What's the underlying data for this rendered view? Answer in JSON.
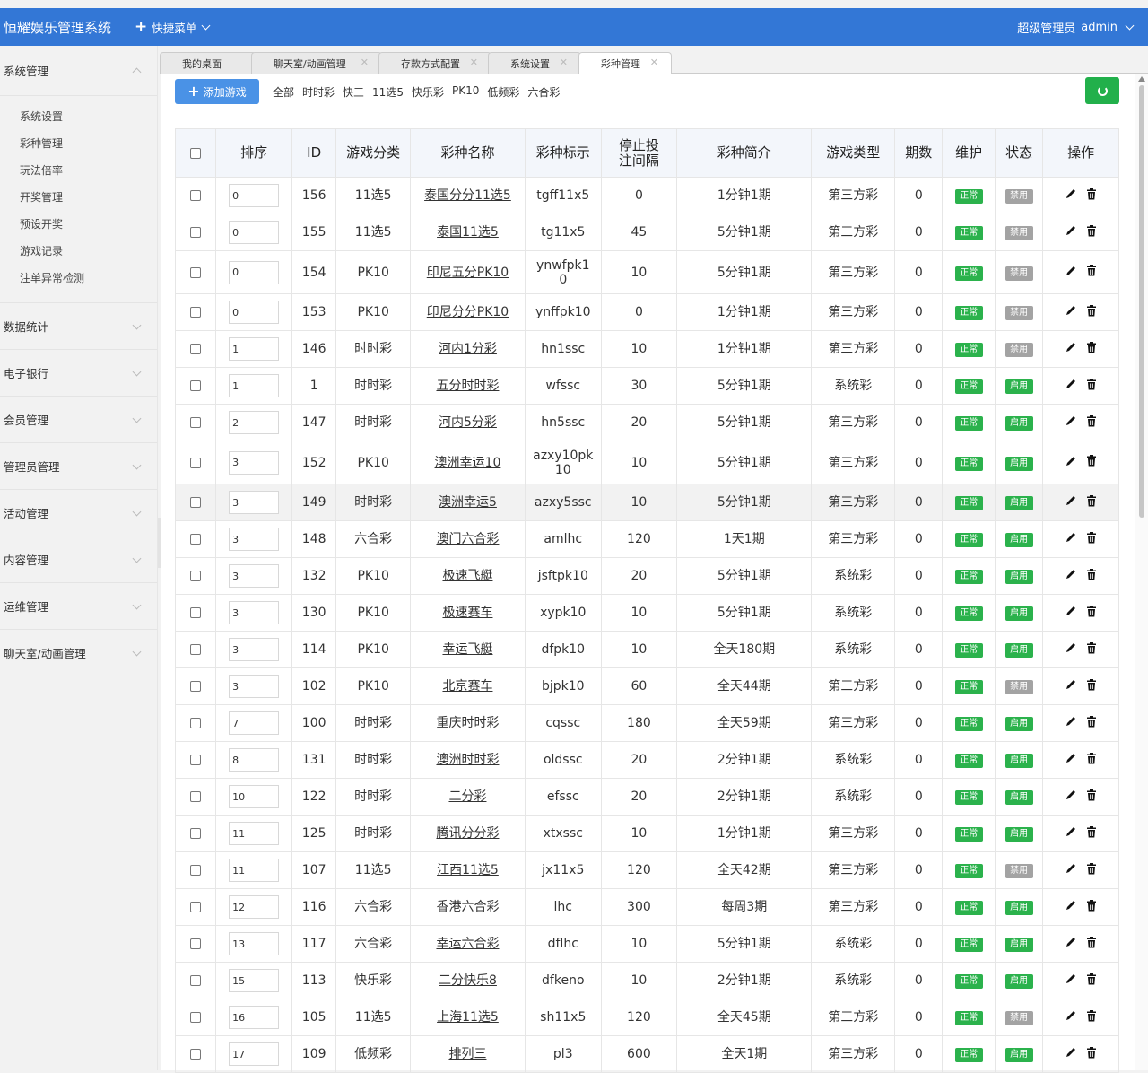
{
  "header": {
    "brand": "恒耀娱乐管理系统",
    "quick_menu": "快捷菜单",
    "user_role": "超级管理员",
    "user_name": "admin"
  },
  "sidebar": {
    "expanded": {
      "label": "系统管理",
      "items": [
        "系统设置",
        "彩种管理",
        "玩法倍率",
        "开奖管理",
        "预设开奖",
        "游戏记录",
        "注单异常检测"
      ]
    },
    "groups": [
      "数据统计",
      "电子银行",
      "会员管理",
      "管理员管理",
      "活动管理",
      "内容管理",
      "运维管理",
      "聊天室/动画管理"
    ]
  },
  "tabs": [
    {
      "label": "我的桌面",
      "closable": false
    },
    {
      "label": "聊天室/动画管理",
      "closable": true
    },
    {
      "label": "存款方式配置",
      "closable": true
    },
    {
      "label": "系统设置",
      "closable": true
    },
    {
      "label": "彩种管理",
      "closable": true,
      "active": true
    }
  ],
  "toolbar": {
    "add_label": "添加游戏",
    "filters": [
      "全部",
      "时时彩",
      "快三",
      "11选5",
      "快乐彩",
      "PK10",
      "低频彩",
      "六合彩"
    ]
  },
  "table": {
    "headers": [
      "排序",
      "ID",
      "游戏分类",
      "彩种名称",
      "彩种标示",
      "停止投注间隔",
      "彩种简介",
      "游戏类型",
      "期数",
      "维护",
      "状态",
      "操作"
    ],
    "rows": [
      {
        "sort": "0",
        "id": "156",
        "cat": "11选5",
        "name": "泰国分分11选5",
        "code": "tgff11x5",
        "stop": "0",
        "intro": "1分钟1期",
        "type": "第三方彩",
        "periods": "0",
        "maint": "正常",
        "status": "禁用"
      },
      {
        "sort": "0",
        "id": "155",
        "cat": "11选5",
        "name": "泰国11选5",
        "code": "tg11x5",
        "stop": "45",
        "intro": "5分钟1期",
        "type": "第三方彩",
        "periods": "0",
        "maint": "正常",
        "status": "禁用"
      },
      {
        "sort": "0",
        "id": "154",
        "cat": "PK10",
        "name": "印尼五分PK10",
        "code": "ynwfpk10",
        "stop": "10",
        "intro": "5分钟1期",
        "type": "第三方彩",
        "periods": "0",
        "maint": "正常",
        "status": "禁用"
      },
      {
        "sort": "0",
        "id": "153",
        "cat": "PK10",
        "name": "印尼分分PK10",
        "code": "ynffpk10",
        "stop": "0",
        "intro": "1分钟1期",
        "type": "第三方彩",
        "periods": "0",
        "maint": "正常",
        "status": "禁用"
      },
      {
        "sort": "1",
        "id": "146",
        "cat": "时时彩",
        "name": "河内1分彩",
        "code": "hn1ssc",
        "stop": "10",
        "intro": "1分钟1期",
        "type": "第三方彩",
        "periods": "0",
        "maint": "正常",
        "status": "禁用"
      },
      {
        "sort": "1",
        "id": "1",
        "cat": "时时彩",
        "name": "五分时时彩",
        "code": "wfssc",
        "stop": "30",
        "intro": "5分钟1期",
        "type": "系统彩",
        "periods": "0",
        "maint": "正常",
        "status": "启用"
      },
      {
        "sort": "2",
        "id": "147",
        "cat": "时时彩",
        "name": "河内5分彩",
        "code": "hn5ssc",
        "stop": "20",
        "intro": "5分钟1期",
        "type": "第三方彩",
        "periods": "0",
        "maint": "正常",
        "status": "启用"
      },
      {
        "sort": "3",
        "id": "152",
        "cat": "PK10",
        "name": "澳洲幸运10",
        "code": "azxy10pk10",
        "stop": "10",
        "intro": "5分钟1期",
        "type": "第三方彩",
        "periods": "0",
        "maint": "正常",
        "status": "启用"
      },
      {
        "sort": "3",
        "id": "149",
        "cat": "时时彩",
        "name": "澳洲幸运5",
        "code": "azxy5ssc",
        "stop": "10",
        "intro": "5分钟1期",
        "type": "第三方彩",
        "periods": "0",
        "maint": "正常",
        "status": "启用"
      },
      {
        "sort": "3",
        "id": "148",
        "cat": "六合彩",
        "name": "澳门六合彩",
        "code": "amlhc",
        "stop": "120",
        "intro": "1天1期",
        "type": "第三方彩",
        "periods": "0",
        "maint": "正常",
        "status": "启用"
      },
      {
        "sort": "3",
        "id": "132",
        "cat": "PK10",
        "name": "极速飞艇",
        "code": "jsftpk10",
        "stop": "20",
        "intro": "5分钟1期",
        "type": "系统彩",
        "periods": "0",
        "maint": "正常",
        "status": "启用"
      },
      {
        "sort": "3",
        "id": "130",
        "cat": "PK10",
        "name": "极速赛车",
        "code": "xypk10",
        "stop": "10",
        "intro": "5分钟1期",
        "type": "系统彩",
        "periods": "0",
        "maint": "正常",
        "status": "启用"
      },
      {
        "sort": "3",
        "id": "114",
        "cat": "PK10",
        "name": "幸运飞艇",
        "code": "dfpk10",
        "stop": "10",
        "intro": "全天180期",
        "type": "系统彩",
        "periods": "0",
        "maint": "正常",
        "status": "启用"
      },
      {
        "sort": "3",
        "id": "102",
        "cat": "PK10",
        "name": "北京赛车",
        "code": "bjpk10",
        "stop": "60",
        "intro": "全天44期",
        "type": "第三方彩",
        "periods": "0",
        "maint": "正常",
        "status": "禁用"
      },
      {
        "sort": "7",
        "id": "100",
        "cat": "时时彩",
        "name": "重庆时时彩",
        "code": "cqssc",
        "stop": "180",
        "intro": "全天59期",
        "type": "第三方彩",
        "periods": "0",
        "maint": "正常",
        "status": "启用"
      },
      {
        "sort": "8",
        "id": "131",
        "cat": "时时彩",
        "name": "澳洲时时彩",
        "code": "oldssc",
        "stop": "20",
        "intro": "2分钟1期",
        "type": "系统彩",
        "periods": "0",
        "maint": "正常",
        "status": "启用"
      },
      {
        "sort": "10",
        "id": "122",
        "cat": "时时彩",
        "name": "二分彩",
        "code": "efssc",
        "stop": "20",
        "intro": "2分钟1期",
        "type": "系统彩",
        "periods": "0",
        "maint": "正常",
        "status": "启用"
      },
      {
        "sort": "11",
        "id": "125",
        "cat": "时时彩",
        "name": "腾讯分分彩",
        "code": "xtxssc",
        "stop": "10",
        "intro": "1分钟1期",
        "type": "第三方彩",
        "periods": "0",
        "maint": "正常",
        "status": "启用"
      },
      {
        "sort": "11",
        "id": "107",
        "cat": "11选5",
        "name": "江西11选5",
        "code": "jx11x5",
        "stop": "120",
        "intro": "全天42期",
        "type": "第三方彩",
        "periods": "0",
        "maint": "正常",
        "status": "禁用"
      },
      {
        "sort": "12",
        "id": "116",
        "cat": "六合彩",
        "name": "香港六合彩",
        "code": "lhc",
        "stop": "300",
        "intro": "每周3期",
        "type": "第三方彩",
        "periods": "0",
        "maint": "正常",
        "status": "启用"
      },
      {
        "sort": "13",
        "id": "117",
        "cat": "六合彩",
        "name": "幸运六合彩",
        "code": "dflhc",
        "stop": "10",
        "intro": "5分钟1期",
        "type": "系统彩",
        "periods": "0",
        "maint": "正常",
        "status": "启用"
      },
      {
        "sort": "15",
        "id": "113",
        "cat": "快乐彩",
        "name": "二分快乐8",
        "code": "dfkeno",
        "stop": "10",
        "intro": "2分钟1期",
        "type": "系统彩",
        "periods": "0",
        "maint": "正常",
        "status": "启用"
      },
      {
        "sort": "16",
        "id": "105",
        "cat": "11选5",
        "name": "上海11选5",
        "code": "sh11x5",
        "stop": "120",
        "intro": "全天45期",
        "type": "第三方彩",
        "periods": "0",
        "maint": "正常",
        "status": "禁用"
      },
      {
        "sort": "17",
        "id": "109",
        "cat": "低频彩",
        "name": "排列三",
        "code": "pl3",
        "stop": "600",
        "intro": "全天1期",
        "type": "第三方彩",
        "periods": "0",
        "maint": "正常",
        "status": "启用"
      }
    ]
  },
  "colors": {
    "primary": "#3377d6",
    "green": "#2bb24c",
    "gray_badge": "#a3a3a3",
    "refresh": "#22b04b"
  }
}
